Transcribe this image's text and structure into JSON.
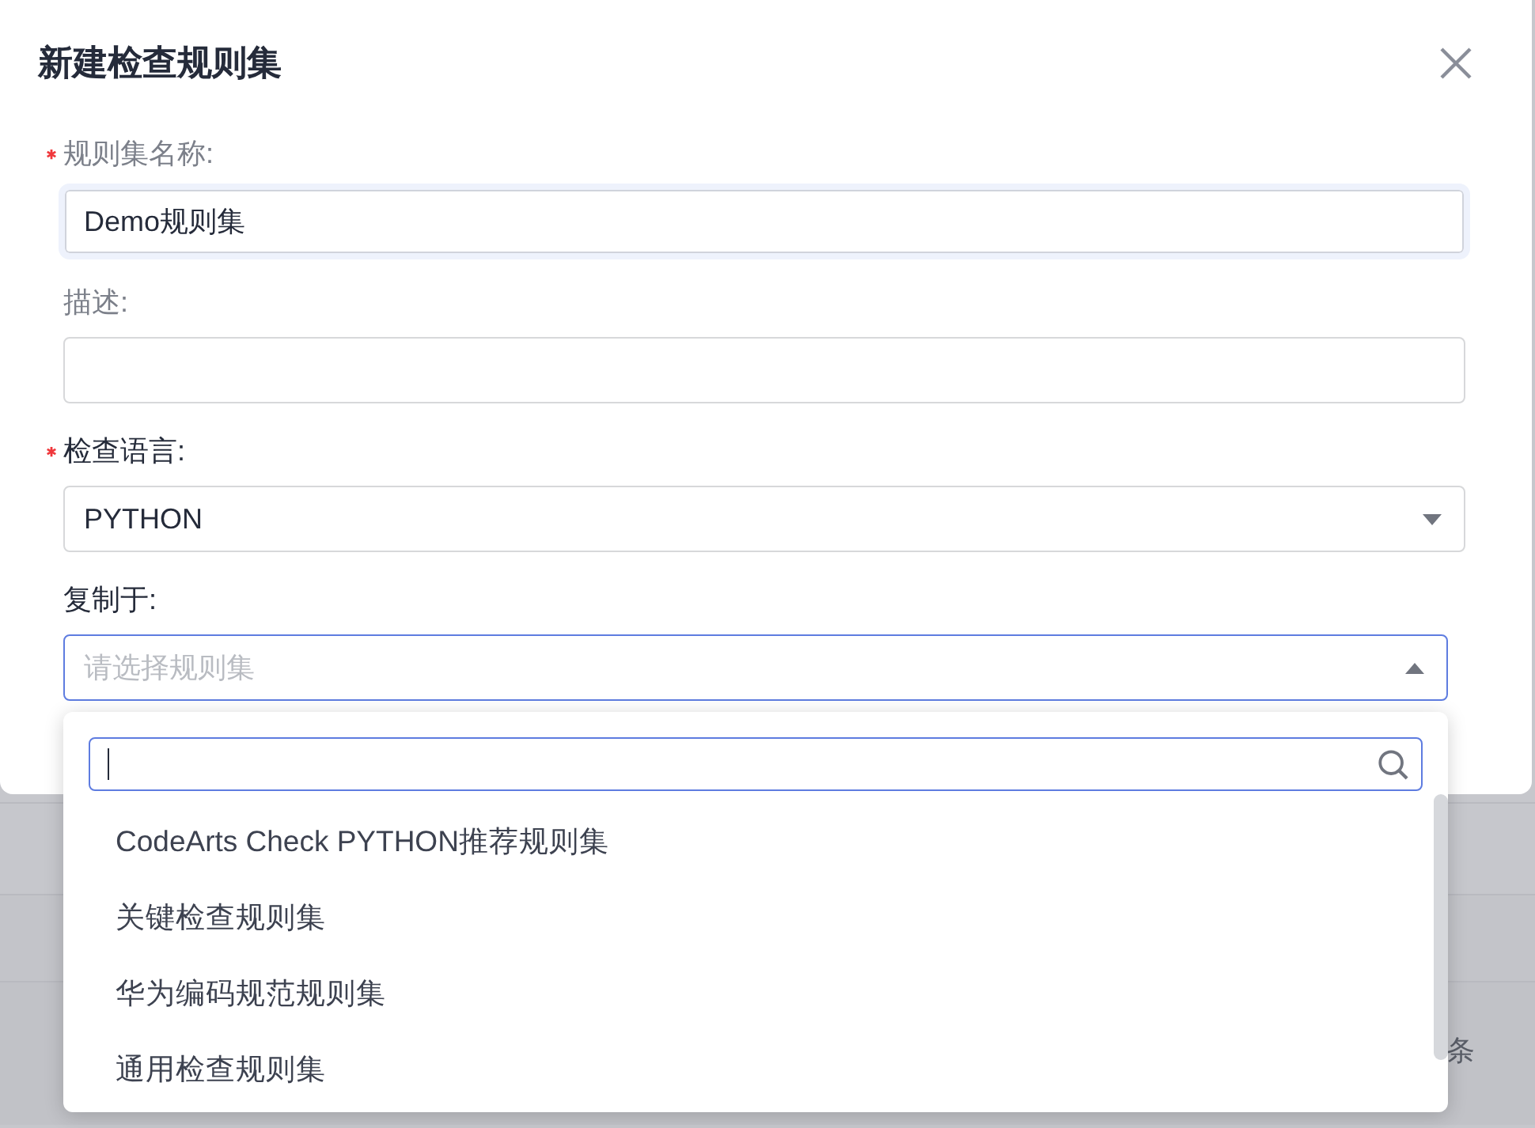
{
  "dialog": {
    "title": "新建检查规则集",
    "fields": [
      {
        "kind": "input",
        "label": "规则集名称:",
        "required": true,
        "focused": true,
        "value": "Demo规则集"
      },
      {
        "kind": "input",
        "label": "描述:",
        "required": false,
        "focused": false
      },
      {
        "kind": "select",
        "label": "检查语言:",
        "required": true,
        "expanded": false,
        "value": "PYTHON"
      },
      {
        "kind": "select",
        "label": "复制于:",
        "required": false,
        "expanded": true,
        "placeholder": "请选择规则集"
      }
    ]
  },
  "dropdown": {
    "search": {
      "focused": true
    },
    "options": [
      {
        "label": "CodeArts Check PYTHON推荐规则集",
        "selected": false
      },
      {
        "label": "关键检查规则集",
        "selected": false
      },
      {
        "label": "华为编码规范规则集",
        "selected": false
      },
      {
        "label": "通用检查规则集",
        "selected": false
      }
    ]
  },
  "background": {
    "pagination_text": "条"
  }
}
